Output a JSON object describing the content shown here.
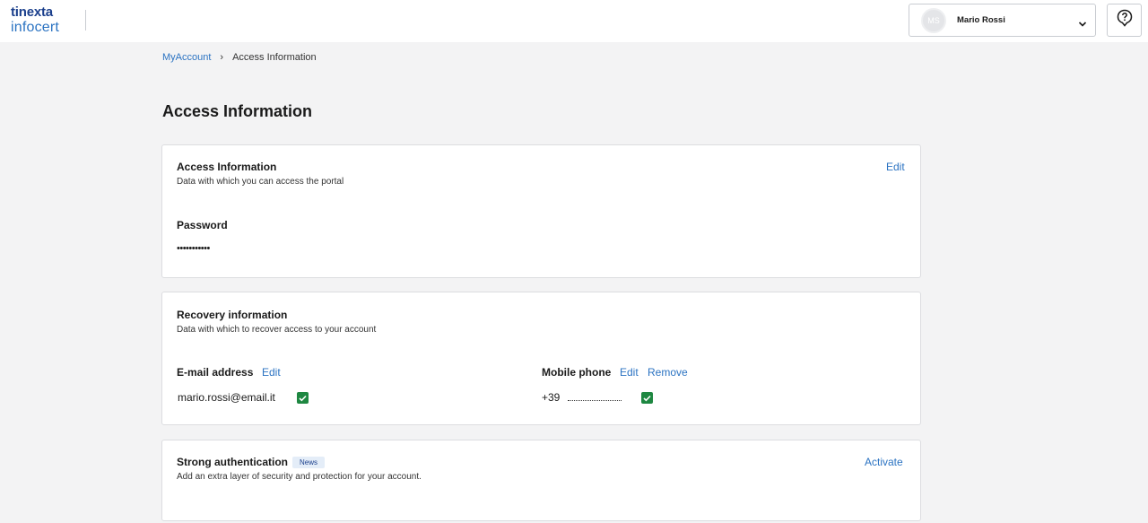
{
  "brand": {
    "line1": "tinexta",
    "line2": "infocert",
    "color": "#1b5fab"
  },
  "user": {
    "initials": "MS",
    "name": "Mario Rossi"
  },
  "icons": {
    "chevron": "chevron-down-icon",
    "help": "question-icon",
    "check": "check-icon"
  },
  "breadcrumb": {
    "root": "MyAccount",
    "separator": "›",
    "current": "Access Information"
  },
  "page": {
    "title": "Access Information"
  },
  "access_card": {
    "title": "Access Information",
    "subtitle": "Data with which you can access the portal",
    "edit_label": "Edit",
    "password_label": "Password",
    "password_value": "•••••••••••"
  },
  "recovery_card": {
    "title": "Recovery information",
    "subtitle": "Data with which to recover access to your account",
    "email_label": "E-mail address",
    "email_edit": "Edit",
    "email_value": "mario.rossi@email.it",
    "phone_label": "Mobile phone",
    "phone_edit": "Edit",
    "phone_remove": "Remove",
    "phone_prefix": "+39"
  },
  "strong_auth_card": {
    "title": "Strong authentication",
    "badge": "News",
    "subtitle": "Add an extra layer of security and protection for your account.",
    "activate_label": "Activate"
  },
  "colors": {
    "accent": "#2b73c2",
    "success": "#1e8741",
    "background": "#f3f3f4"
  }
}
